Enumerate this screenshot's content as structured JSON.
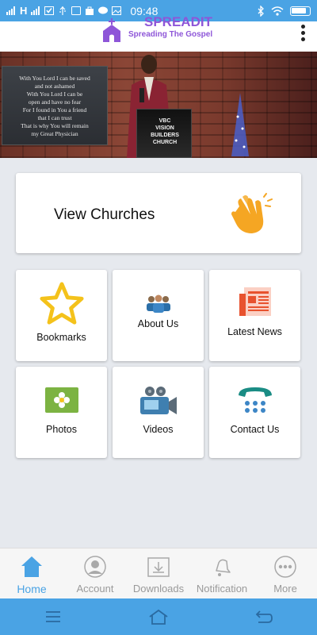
{
  "status_bar": {
    "time": "09:48",
    "carrier_text": "H"
  },
  "header": {
    "brand": "SPREADIT",
    "tagline": "Spreading The Gospel"
  },
  "banner": {
    "lyrics": [
      "With You Lord I can be saved",
      "and not ashamed",
      "With You Lord I can be",
      "open and have no fear",
      "For I found in You a friend",
      "that I can trust",
      "That is why You will remain",
      "my Great Physician"
    ],
    "pulpit": [
      "VBC",
      "VISION",
      "BUILDERS",
      "CHURCH"
    ]
  },
  "main": {
    "view_churches": "View Churches",
    "tiles": [
      {
        "label": "Bookmarks",
        "icon": "star-icon"
      },
      {
        "label": "About Us",
        "icon": "group-icon"
      },
      {
        "label": "Latest News",
        "icon": "newspaper-icon"
      },
      {
        "label": "Photos",
        "icon": "photo-icon"
      },
      {
        "label": "Videos",
        "icon": "video-camera-icon"
      },
      {
        "label": "Contact Us",
        "icon": "phone-icon"
      }
    ]
  },
  "bottom_nav": [
    {
      "label": "Home",
      "active": true
    },
    {
      "label": "Account",
      "active": false
    },
    {
      "label": "Downloads",
      "active": false
    },
    {
      "label": "Notification",
      "active": false
    },
    {
      "label": "More",
      "active": false
    }
  ],
  "colors": {
    "accent": "#4aa3e4",
    "brand": "#8e56d8",
    "hands": "#f5a623",
    "star": "#f4c21b"
  }
}
